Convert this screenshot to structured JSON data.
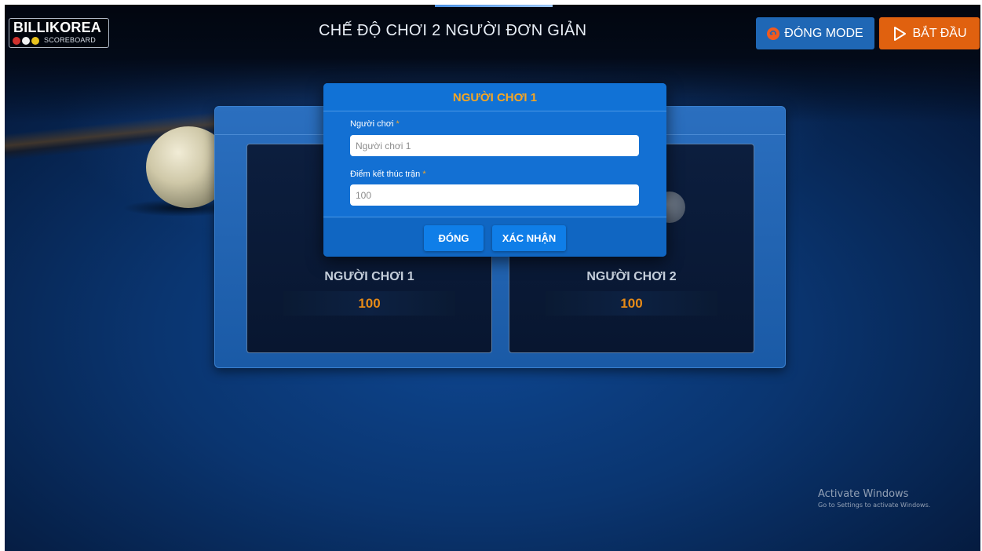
{
  "header": {
    "logo": {
      "title": "BILLIKOREA",
      "subtitle": "SCOREBOARD",
      "dot_colors": [
        "#d0312d",
        "#f2f2f2",
        "#e8c21e"
      ]
    },
    "title": "CHẾ ĐỘ CHƠI 2 NGƯỜI ĐƠN GIẢN",
    "close_mode_label": "ĐÓNG MODE",
    "start_label": "BẮT ĐẦU"
  },
  "players": [
    {
      "name": "NGƯỜI CHƠI 1",
      "score": "100"
    },
    {
      "name": "NGƯỜI CHƠI 2",
      "score": "100"
    }
  ],
  "modal": {
    "title": "NGƯỜI CHƠI 1",
    "player_label": "Người chơi",
    "player_placeholder": "Người chơi 1",
    "end_score_label": "Điểm kết thúc trận",
    "end_score_placeholder": "100",
    "required_mark": "*",
    "close_label": "ĐÓNG",
    "confirm_label": "XÁC NHẬN"
  },
  "watermark": {
    "title": "Activate Windows",
    "subtitle": "Go to Settings to activate Windows."
  },
  "colors": {
    "accent_orange": "#f5a623",
    "score_orange": "#e68a17",
    "start_button": "#e0610f",
    "close_mode_button": "#1f67b5",
    "modal_blue": "#1370d3"
  },
  "icons": {
    "close_mode": "close-circle-icon",
    "start": "play-icon"
  }
}
